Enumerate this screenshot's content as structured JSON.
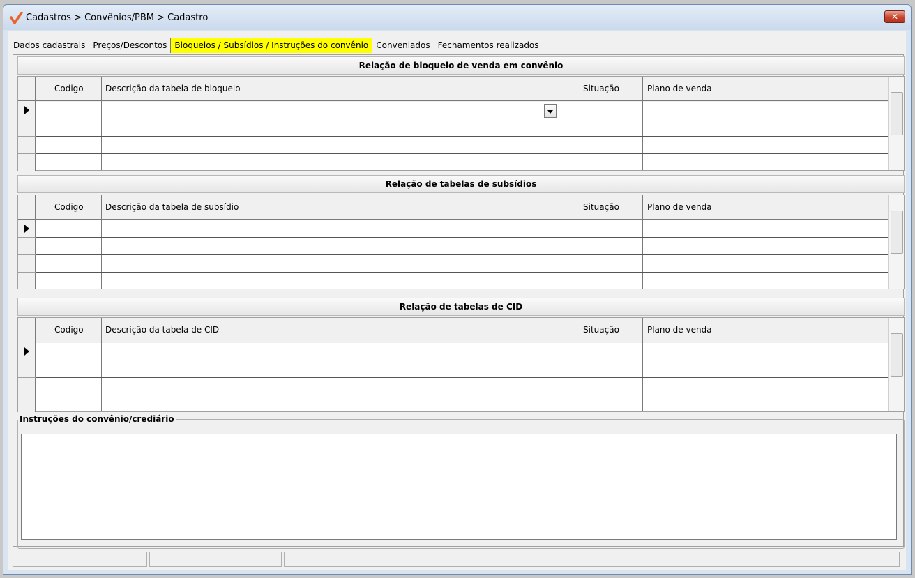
{
  "window": {
    "title": "Cadastros > Convênios/PBM > Cadastro",
    "close_label": "✕"
  },
  "tabs": [
    {
      "label": "Dados cadastrais",
      "active": false
    },
    {
      "label": "Preços/Descontos",
      "active": false
    },
    {
      "label": "Bloqueios / Subsídios / Instruções do convênio",
      "active": true
    },
    {
      "label": "Conveniados",
      "active": false
    },
    {
      "label": "Fechamentos realizados",
      "active": false
    }
  ],
  "sections": {
    "bloqueio": {
      "title": "Relação de bloqueio de venda em convênio",
      "columns": [
        "Codigo",
        "Descrição da tabela de bloqueio",
        "Situação",
        "Plano de venda"
      ]
    },
    "subsidio": {
      "title": "Relação de tabelas de subsídios",
      "columns": [
        "Codigo",
        "Descrição da tabela de subsídio",
        "Situação",
        "Plano de venda"
      ]
    },
    "cid": {
      "title": "Relação de tabelas de CID",
      "columns": [
        "Codigo",
        "Descrição da tabela de CID",
        "Situação",
        "Plano de venda"
      ]
    }
  },
  "instructions": {
    "label": "Instruções do convênio/crediário",
    "value": ""
  },
  "colors": {
    "active_tab": "#ffff00",
    "close_button": "#c7442e",
    "logo": "#e8642a"
  }
}
